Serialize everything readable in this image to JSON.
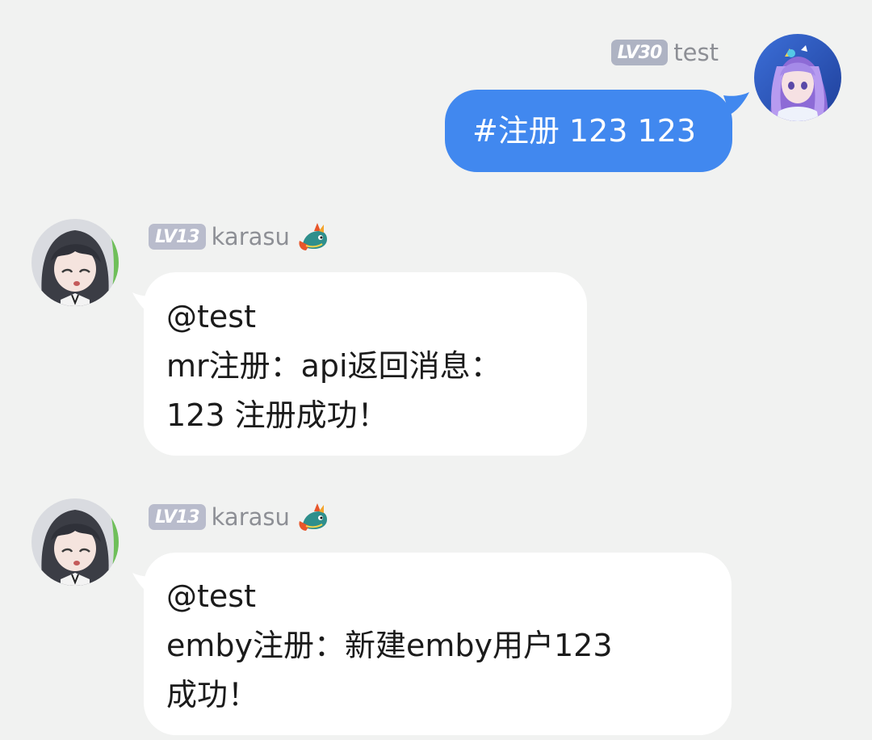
{
  "messages": [
    {
      "sender": "test",
      "level": "LV30",
      "direction": "outgoing",
      "text": "#注册 123 123"
    },
    {
      "sender": "karasu",
      "level": "LV13",
      "direction": "incoming",
      "lines": [
        "@test",
        "mr注册：api返回消息：",
        "123 注册成功！"
      ]
    },
    {
      "sender": "karasu",
      "level": "LV13",
      "direction": "incoming",
      "lines": [
        "@test",
        "emby注册：新建emby用户123",
        "成功！"
      ]
    }
  ],
  "colors": {
    "background": "#f1f2f1",
    "outgoing_bubble": "#4188ef",
    "incoming_bubble": "#ffffff",
    "level_badge": "#b9bccc",
    "username": "#8d8f95"
  },
  "icons": {
    "sender_badge": "dragon-icon"
  }
}
